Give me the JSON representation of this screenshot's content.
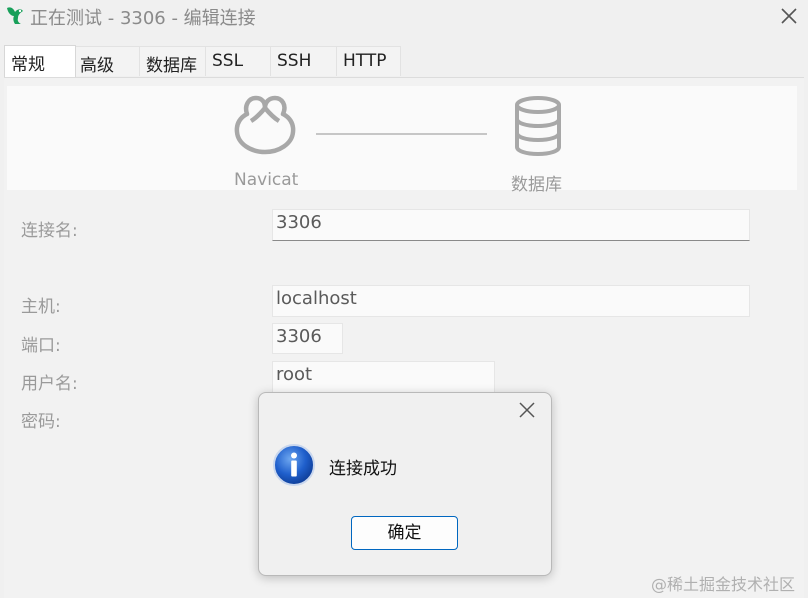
{
  "window": {
    "title": "正在测试 - 3306 - 编辑连接",
    "icon": "navicat-app-icon"
  },
  "tabs": [
    {
      "label": "常规",
      "active": true
    },
    {
      "label": "高级"
    },
    {
      "label": "数据库"
    },
    {
      "label": "SSL"
    },
    {
      "label": "SSH"
    },
    {
      "label": "HTTP"
    }
  ],
  "banner": {
    "client_label": "Navicat",
    "server_label": "数据库",
    "client_icon": "navicat-logo-icon",
    "server_icon": "database-icon"
  },
  "form": {
    "connection_name": {
      "label": "连接名:",
      "value": "3306"
    },
    "host": {
      "label": "主机:",
      "value": "localhost"
    },
    "port": {
      "label": "端口:",
      "value": "3306"
    },
    "username": {
      "label": "用户名:",
      "value": "root"
    },
    "password": {
      "label": "密码:"
    }
  },
  "dialog": {
    "message": "连接成功",
    "ok_label": "确定",
    "icon": "info-icon",
    "accent_color": "#0067c0"
  },
  "watermark": "@稀土掘金技术社区"
}
